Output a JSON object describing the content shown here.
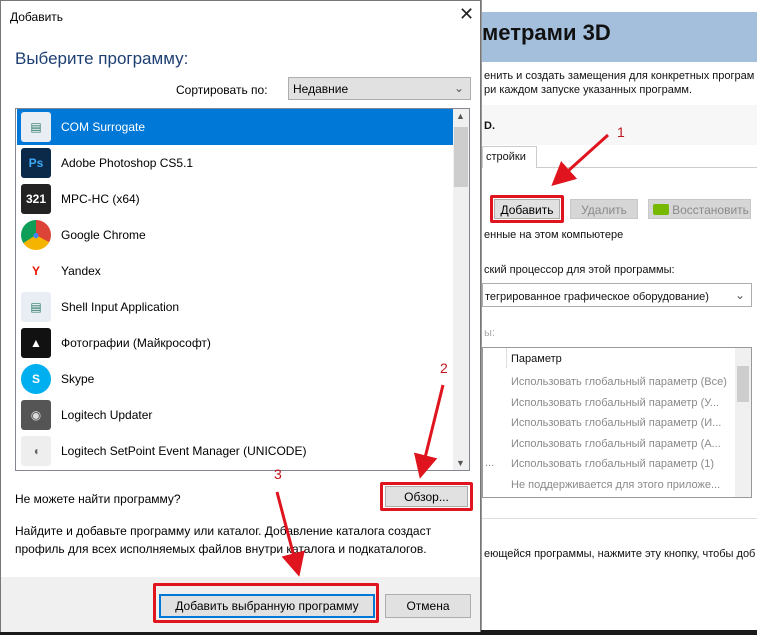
{
  "background_window": {
    "title": "метрами 3D",
    "desc_line1": "енить и создать замещения для конкретных програм",
    "desc_line2": "ри каждом запуске указанных программ.",
    "section_label": "D.",
    "tab": "стройки",
    "add_button": "Добавить",
    "remove_button": "Удалить",
    "restore_button": "Восстановить",
    "installed_label": "енные на этом компьютере",
    "gpu_label": "ский процессор для этой программы:",
    "gpu_select": "тегрированное графическое оборудование)",
    "settings_label": "ы:",
    "table_header": "Параметр",
    "table_rows": [
      "Использовать глобальный параметр (Все)",
      "Использовать глобальный параметр (У...",
      "Использовать глобальный параметр (И...",
      "Использовать глобальный параметр (А...",
      "Использовать глобальный параметр (1)",
      "Не поддерживается для этого приложе..."
    ],
    "left_ellipsis": "...",
    "bottom_text": "еющейся программы, нажмите эту кнопку, чтобы доб"
  },
  "dialog": {
    "title": "Добавить",
    "heading": "Выберите программу:",
    "sort_label": "Сортировать по:",
    "sort_value": "Недавние",
    "programs": [
      {
        "name": "COM Surrogate",
        "icon": "window-icon",
        "selected": true
      },
      {
        "name": "Adobe Photoshop CS5.1",
        "icon": "photoshop-icon"
      },
      {
        "name": "MPC-HC (x64)",
        "icon": "mpc-icon"
      },
      {
        "name": "Google Chrome",
        "icon": "chrome-icon"
      },
      {
        "name": "Yandex",
        "icon": "yandex-icon"
      },
      {
        "name": "Shell Input Application",
        "icon": "window-icon"
      },
      {
        "name": "Фотографии (Майкрософт)",
        "icon": "photos-icon"
      },
      {
        "name": "Skype",
        "icon": "skype-icon"
      },
      {
        "name": "Logitech Updater",
        "icon": "logitech-icon"
      },
      {
        "name": "Logitech SetPoint Event Manager (UNICODE)",
        "icon": "mouse-icon"
      }
    ],
    "cant_find": "Не можете найти программу?",
    "browse_button": "Обзор...",
    "hint": "Найдите и добавьте программу или каталог. Добавление каталога создаст профиль для всех исполняемых файлов внутри каталога и подкаталогов.",
    "add_selected_button": "Добавить выбранную программу",
    "cancel_button": "Отмена"
  },
  "annotations": [
    "1",
    "2",
    "3"
  ],
  "colors": {
    "accent": "#0078d7",
    "heading": "#1e3f73",
    "highlight": "#e0141e",
    "header": "#a4bfdc"
  }
}
